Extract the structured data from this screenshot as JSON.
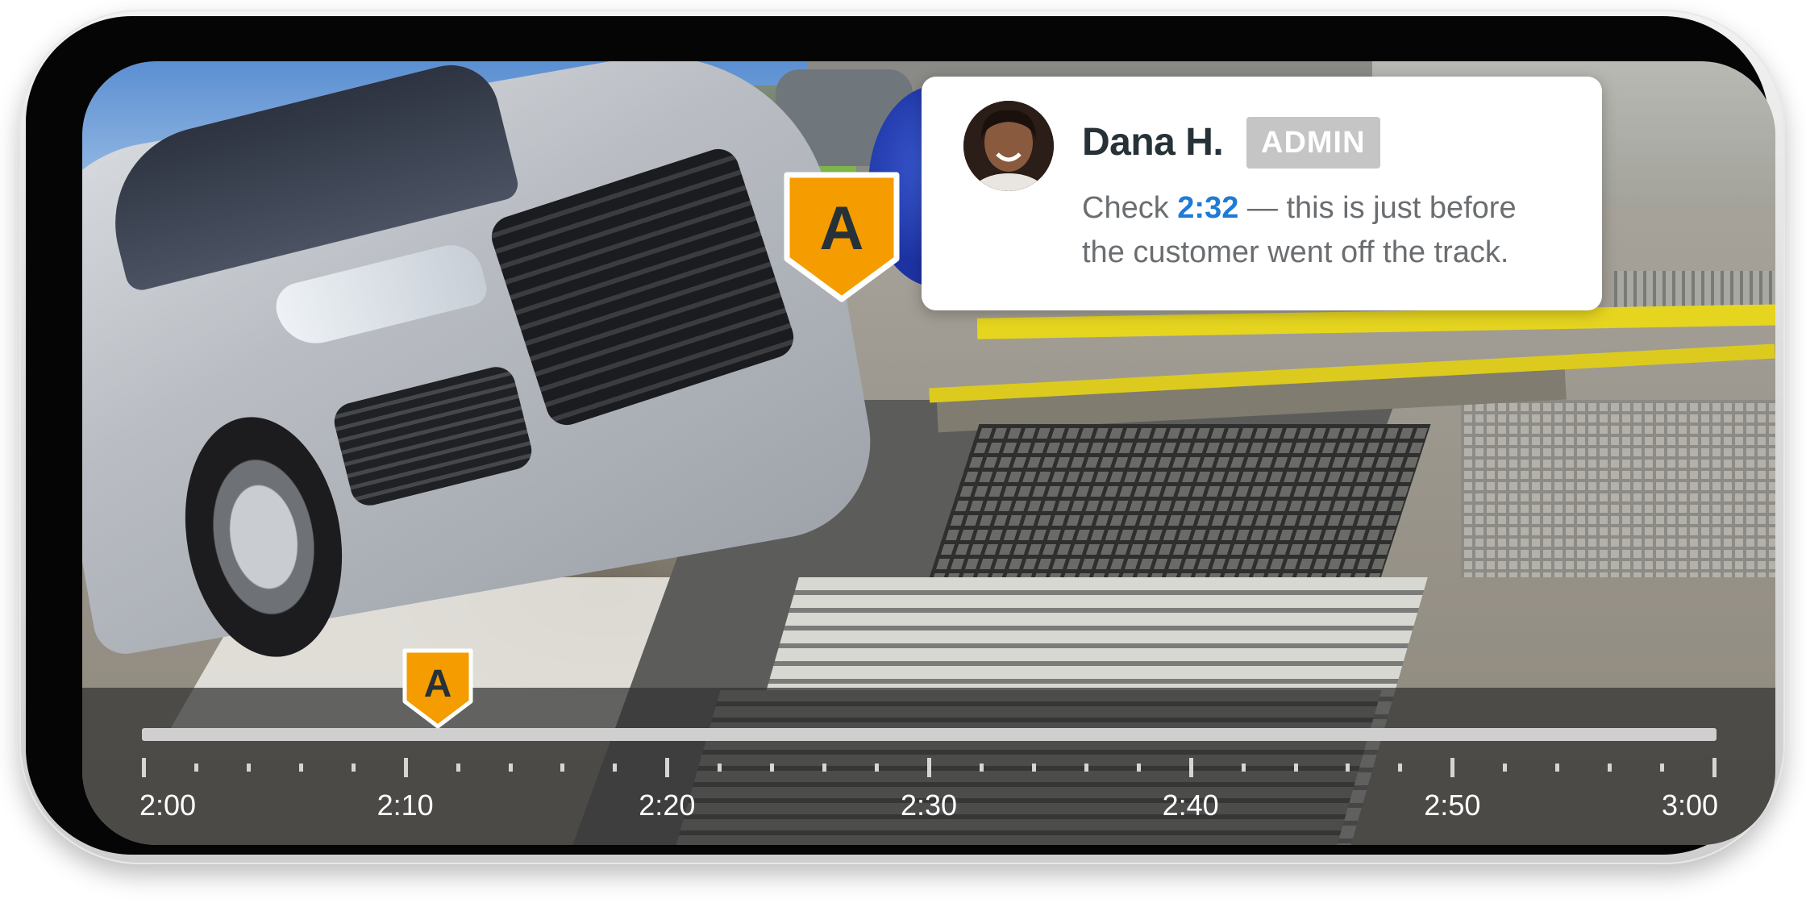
{
  "comment": {
    "author": "Dana H.",
    "role": "ADMIN",
    "text_prefix": "Check ",
    "timestamp": "2:32",
    "text_suffix": " — this is just before the customer went off the track."
  },
  "markers": [
    {
      "label": "A",
      "time": "2:12",
      "color": "#f59c00"
    }
  ],
  "timeline": {
    "start": "2:00",
    "end": "3:00",
    "labels": [
      "2:00",
      "2:10",
      "2:20",
      "2:30",
      "2:40",
      "2:50",
      "3:00"
    ]
  },
  "colors": {
    "marker": "#f59c00",
    "timestamp_link": "#1e7bd6",
    "badge": "#c5c5c5"
  }
}
